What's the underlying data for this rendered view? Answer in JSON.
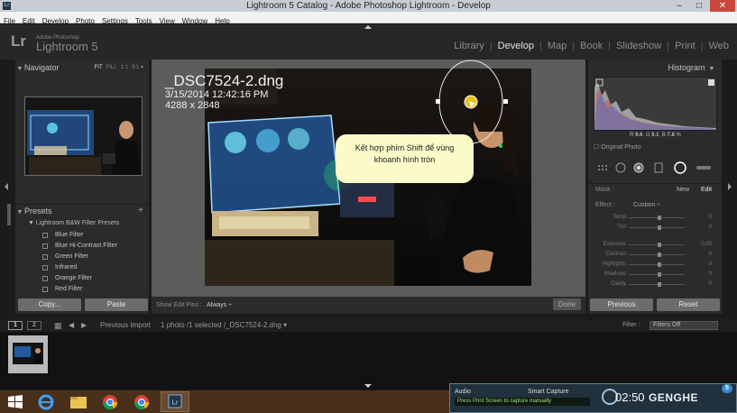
{
  "window": {
    "title": "Lightroom 5 Catalog - Adobe Photoshop Lightroom - Develop",
    "app_icon": "Lr",
    "minimize": "–",
    "maximize": "□",
    "close": "✕"
  },
  "menu": [
    "File",
    "Edit",
    "Develop",
    "Photo",
    "Settings",
    "Tools",
    "View",
    "Window",
    "Help"
  ],
  "identity": {
    "logo": "Lr",
    "vendor": "Adobe Photoshop",
    "product": "Lightroom 5"
  },
  "modules": {
    "items": [
      "Library",
      "Develop",
      "Map",
      "Book",
      "Slideshow",
      "Print",
      "Web"
    ],
    "active": "Develop",
    "separator": "|"
  },
  "left_panel": {
    "navigator_title": "Navigator",
    "nav_options": [
      "FIT",
      "FILL",
      "1:1",
      "3:1 ▾"
    ],
    "presets_title": "Presets",
    "presets_add": "+",
    "preset_folder": "Lightroom B&W Filter Presets",
    "presets": [
      "Blue Filter",
      "Blue Hi-Contrast Filter",
      "Green Filter",
      "Infrared",
      "Orange Filter",
      "Red Filter"
    ],
    "copy_button": "Copy...",
    "paste_button": "Paste"
  },
  "image": {
    "filename": "_DSC7524-2.dng",
    "datetime": "3/15/2014 12:42:16 PM",
    "dimensions": "4288 x 2848",
    "callout_line1": "Kết hợp phím Shift để vùng",
    "callout_line2": "khoanh hình tròn"
  },
  "toolbar": {
    "show_edit_pins_label": "Show Edit Pins :",
    "show_edit_pins_value": "Always ÷",
    "done_button": "Done"
  },
  "right_panel": {
    "histogram_title": "Histogram",
    "hist_r_label": "R",
    "hist_r": "9.6",
    "hist_g_label": "G",
    "hist_g": "9.1",
    "hist_b_label": "B",
    "hist_b": "7.8",
    "hist_pct": "%",
    "original_photo": "Original Photo",
    "mask_label": "Mask :",
    "mask_new": "New",
    "mask_edit": "Edit",
    "effect_label": "Effect :",
    "effect_value": "Custom ÷",
    "sliders": [
      {
        "name": "Temp",
        "value": "0"
      },
      {
        "name": "Tint",
        "value": "0"
      },
      {
        "name": "Exposure",
        "value": "0.00"
      },
      {
        "name": "Contrast",
        "value": "0"
      },
      {
        "name": "Highlights",
        "value": "0"
      },
      {
        "name": "Shadows",
        "value": "0"
      },
      {
        "name": "Clarity",
        "value": "0"
      }
    ],
    "previous_button": "Previous",
    "reset_button": "Reset"
  },
  "filmstrip": {
    "screen1": "1",
    "screen2": "2",
    "source": "Previous Import",
    "selection": "1 photo /1 selected /_DSC7524-2.dng ▾",
    "filter_label": "Filter :",
    "filter_value": "Filters Off"
  },
  "recorder": {
    "audio": "Audio",
    "smart_capture": "Smart Capture",
    "hint": "Press Print Screen to capture manually",
    "time": "02:50",
    "logo": "GENGHE",
    "badge": "5"
  },
  "colors": {
    "panel_bg": "#2b2b2b",
    "center_bg": "#5c5c5c",
    "taskbar": "#4a2f1a",
    "callout_bg": "#fbfac9",
    "mask_pin": "#e6c21b"
  }
}
